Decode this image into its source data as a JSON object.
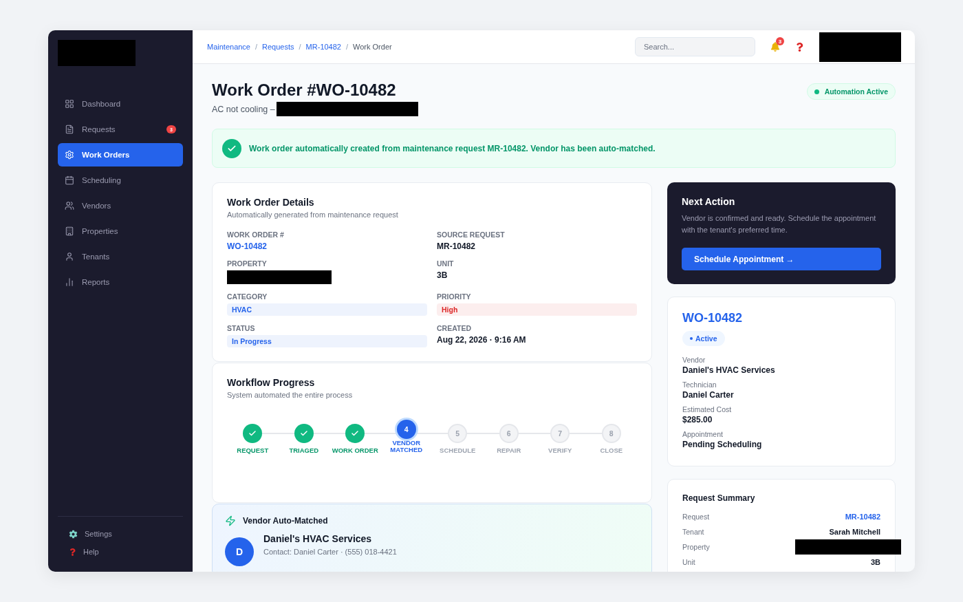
{
  "sidebar": {
    "items": [
      {
        "label": "Dashboard",
        "kind": "grid",
        "selected": false
      },
      {
        "label": "Requests",
        "kind": "file",
        "selected": false,
        "badge": "3"
      },
      {
        "label": "Work Orders",
        "kind": "gear",
        "selected": true
      },
      {
        "label": "Scheduling",
        "kind": "calendar",
        "selected": false
      },
      {
        "label": "Vendors",
        "kind": "users",
        "selected": false
      },
      {
        "label": "Properties",
        "kind": "building",
        "selected": false
      },
      {
        "label": "Tenants",
        "kind": "user",
        "selected": false
      },
      {
        "label": "Reports",
        "kind": "chart",
        "selected": false
      }
    ],
    "footer": [
      {
        "label": "Settings",
        "kind": "gear"
      },
      {
        "label": "Help",
        "kind": "question"
      }
    ]
  },
  "breadcrumb_separator": "/",
  "breadcrumbs": [
    {
      "label": "Maintenance",
      "kind": "link"
    },
    {
      "label": "Requests",
      "kind": "link"
    },
    {
      "label": "MR-10482",
      "kind": "link"
    },
    {
      "label": "Work Order",
      "kind": "current"
    }
  ],
  "search": {
    "placeholder": "Search..."
  },
  "notifications": {
    "badge": "3"
  },
  "page": {
    "title": "Work Order #WO-10482",
    "subtitle": "AC not cooling –",
    "badge": "Automation Active"
  },
  "banner": "Work order automatically created from maintenance request MR-10482. Vendor has been auto-matched.",
  "details": {
    "title": "Work Order Details",
    "subtitle": "Automatically generated from maintenance request",
    "fields": [
      {
        "label": "WORK ORDER #",
        "value": "WO-10482",
        "kind": "link"
      },
      {
        "label": "SOURCE REQUEST",
        "value": "MR-10482",
        "kind": "text"
      },
      {
        "label": "PROPERTY",
        "kind": "redacted"
      },
      {
        "label": "UNIT",
        "value": "3B",
        "kind": "text"
      },
      {
        "label": "CATEGORY",
        "value": "HVAC",
        "kind": "tag",
        "color": "#2563eb"
      },
      {
        "label": "PRIORITY",
        "value": "High",
        "kind": "tag",
        "color": "#dc2626"
      },
      {
        "label": "STATUS",
        "value": "In Progress",
        "kind": "tag",
        "color": "#2563eb"
      },
      {
        "label": "CREATED",
        "value": "Aug 22, 2026 · 9:16 AM",
        "kind": "text"
      }
    ]
  },
  "workflow": {
    "title": "Workflow Progress",
    "subtitle": "System automated the entire process",
    "steps": [
      {
        "label": "REQUEST",
        "done": true,
        "current": false
      },
      {
        "label": "TRIAGED",
        "done": true,
        "current": false
      },
      {
        "label": "WORK ORDER",
        "done": true,
        "current": false
      },
      {
        "label": "VENDOR MATCHED",
        "number": "4",
        "done": false,
        "current": true
      },
      {
        "label": "SCHEDULE",
        "number": "5",
        "done": false,
        "current": false
      },
      {
        "label": "REPAIR",
        "number": "6",
        "done": false,
        "current": false
      },
      {
        "label": "VERIFY",
        "number": "7",
        "done": false,
        "current": false
      },
      {
        "label": "CLOSE",
        "number": "8",
        "done": false,
        "current": false
      }
    ]
  },
  "vendor_match": {
    "title": "Vendor Auto-Matched",
    "avatar": "D",
    "name": "Daniel's HVAC Services",
    "contact": "Contact: Daniel Carter · (555) 018-4421"
  },
  "next_action": {
    "title": "Next Action",
    "text": "Vendor is confirmed and ready. Schedule the appointment with the tenant's preferred time.",
    "button": "Schedule Appointment →"
  },
  "work_order_card": {
    "id": "WO-10482",
    "status": "Active",
    "fields": [
      {
        "label": "Vendor",
        "value": "Daniel's HVAC Services"
      },
      {
        "label": "Technician",
        "value": "Daniel Carter"
      },
      {
        "label": "Estimated Cost",
        "value": "$285.00"
      },
      {
        "label": "Appointment",
        "value": "Pending Scheduling"
      }
    ]
  },
  "request_summary": {
    "title": "Request Summary",
    "rows": [
      {
        "label": "Request",
        "value": "MR-10482",
        "kind": "link"
      },
      {
        "label": "Tenant",
        "value": "Sarah Mitchell",
        "kind": "text"
      },
      {
        "label": "Property",
        "kind": "redacted"
      },
      {
        "label": "Unit",
        "value": "3B",
        "kind": "text"
      }
    ]
  }
}
